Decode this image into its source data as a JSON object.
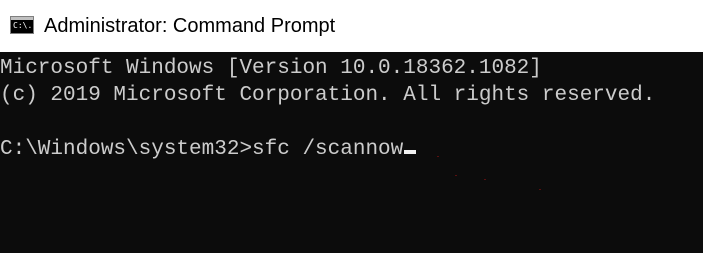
{
  "window": {
    "title": "Administrator: Command Prompt",
    "icon_label": "C:\\."
  },
  "console": {
    "lines": [
      "Microsoft Windows [Version 10.0.18362.1082]",
      "(c) 2019 Microsoft Corporation. All rights reserved.",
      "",
      "C:\\Windows\\system32>sfc /scannow"
    ]
  },
  "colors": {
    "titlebar_bg": "#ffffff",
    "console_bg": "#0c0c0c",
    "console_text": "#cccccc",
    "cursor": "#f2f2f2"
  },
  "icons": {
    "app": "command-prompt-icon"
  }
}
